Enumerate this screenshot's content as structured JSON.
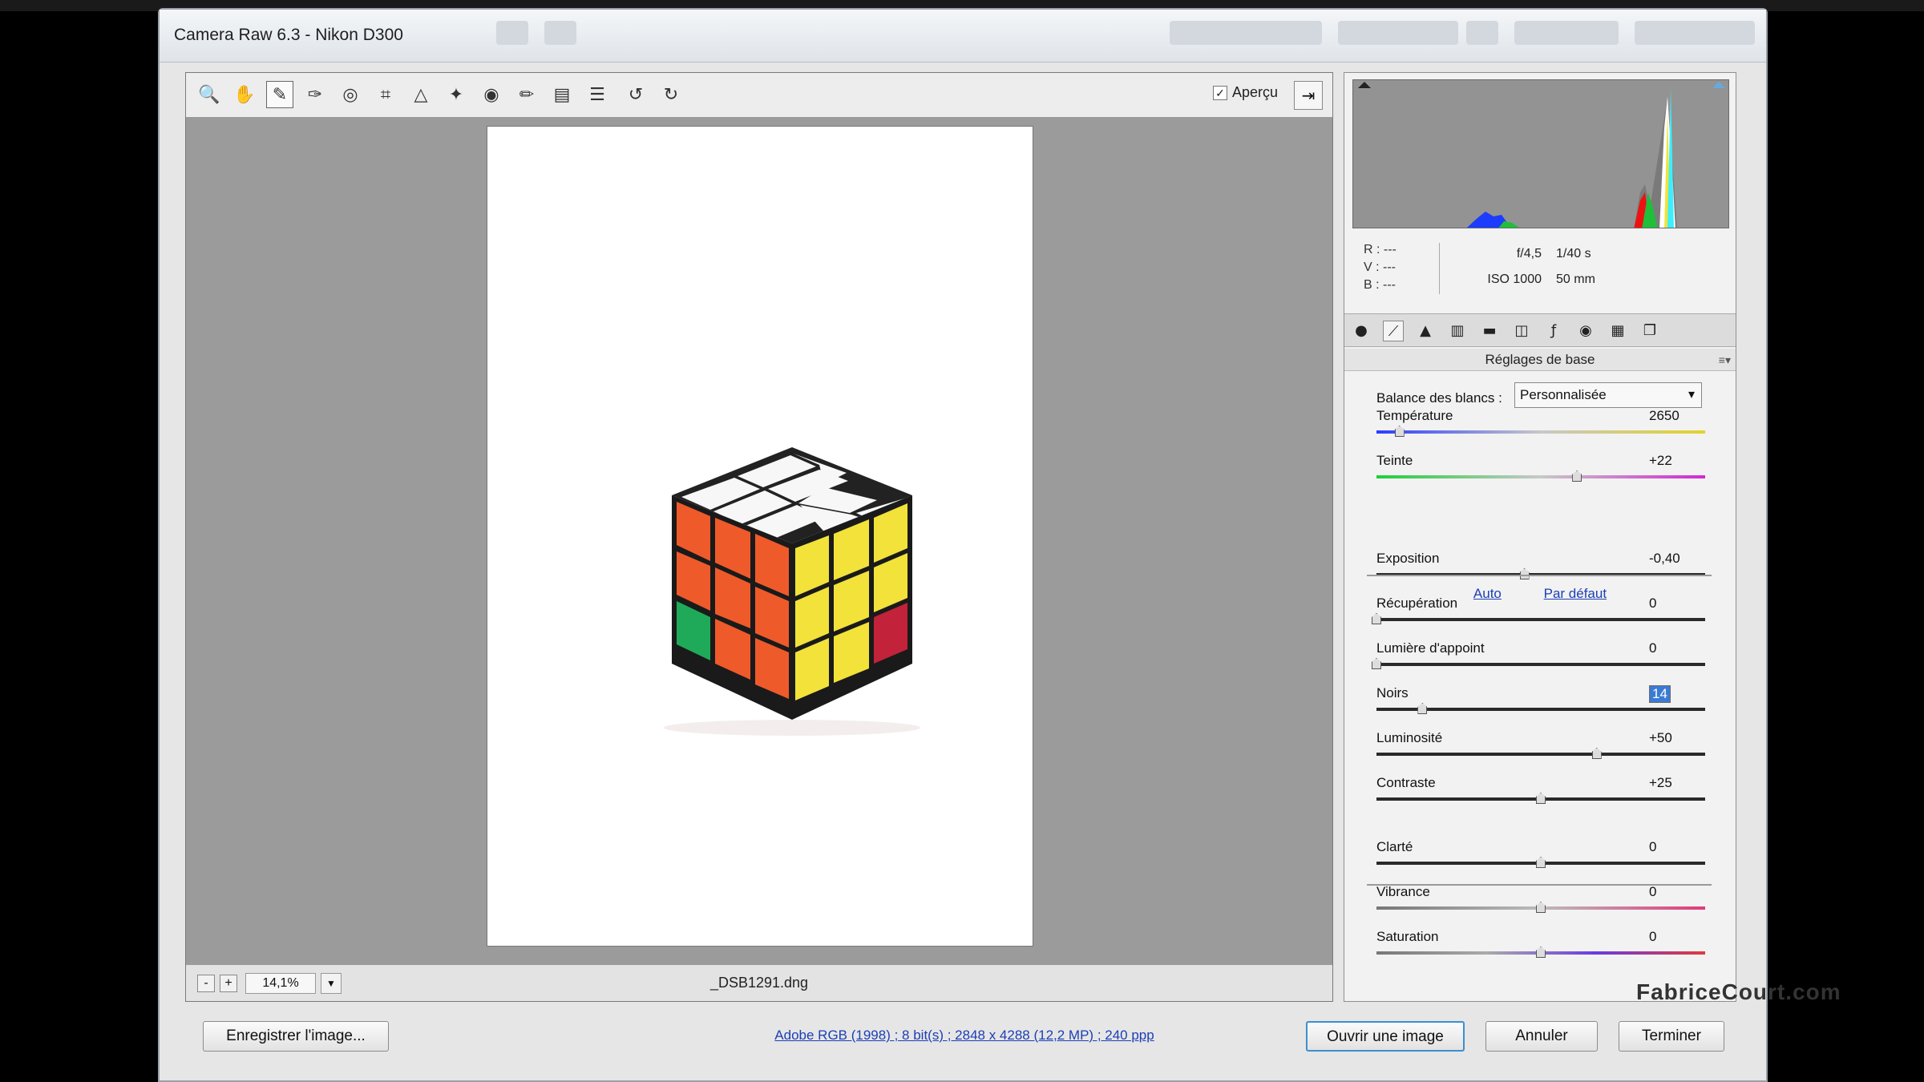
{
  "window": {
    "title": "Camera Raw 6.3  -  Nikon D300"
  },
  "toolbar": {
    "tools": [
      {
        "name": "zoom-tool",
        "glyph": "🔍"
      },
      {
        "name": "hand-tool",
        "glyph": "✋"
      },
      {
        "name": "white-balance-tool",
        "glyph": "✎"
      },
      {
        "name": "color-sampler-tool",
        "glyph": "✑"
      },
      {
        "name": "targeted-adjustment-tool",
        "glyph": "◎"
      },
      {
        "name": "crop-tool",
        "glyph": "⌗"
      },
      {
        "name": "straighten-tool",
        "glyph": "△"
      },
      {
        "name": "spot-removal-tool",
        "glyph": "✦"
      },
      {
        "name": "red-eye-tool",
        "glyph": "◉"
      },
      {
        "name": "adjustment-brush-tool",
        "glyph": "✏"
      },
      {
        "name": "graduated-filter-tool",
        "glyph": "▤"
      },
      {
        "name": "preferences-tool",
        "glyph": "☰"
      },
      {
        "name": "rotate-left-tool",
        "glyph": "↺"
      },
      {
        "name": "rotate-right-tool",
        "glyph": "↻"
      }
    ],
    "preview_label": "Aperçu",
    "preview_checked": "✓"
  },
  "bottombar": {
    "zoom_out": "-",
    "zoom_in": "+",
    "zoom_value": "14,1%",
    "filename": "_DSB1291.dng"
  },
  "info": {
    "rgb": [
      "R :  ---",
      "V :  ---",
      "B :  ---"
    ],
    "aperture": "f/4,5",
    "shutter": "1/40 s",
    "iso": "ISO 1000",
    "focal": "50 mm"
  },
  "panel": {
    "section_title": "Réglages de base",
    "white_balance_label": "Balance des blancs :",
    "white_balance_value": "Personnalisée",
    "link_auto": "Auto",
    "link_default": "Par défaut",
    "sliders": [
      {
        "label": "Température",
        "value": "2650",
        "pos": 0.07
      },
      {
        "label": "Teinte",
        "value": "+22",
        "pos": 0.61
      },
      {
        "label": "Exposition",
        "value": "-0,40",
        "pos": 0.45
      },
      {
        "label": "Récupération",
        "value": "0",
        "pos": 0.0
      },
      {
        "label": "Lumière d'appoint",
        "value": "0",
        "pos": 0.0
      },
      {
        "label": "Noirs",
        "value": "14",
        "pos": 0.14
      },
      {
        "label": "Luminosité",
        "value": "+50",
        "pos": 0.67
      },
      {
        "label": "Contraste",
        "value": "+25",
        "pos": 0.5
      },
      {
        "label": "Clarté",
        "value": "0",
        "pos": 0.5
      },
      {
        "label": "Vibrance",
        "value": "0",
        "pos": 0.5
      },
      {
        "label": "Saturation",
        "value": "0",
        "pos": 0.5
      }
    ]
  },
  "footer": {
    "save_button": "Enregistrer l'image...",
    "info_link": "Adobe RGB (1998) ; 8 bit(s) ; 2848 x 4288 (12,2 MP) ; 240 ppp",
    "open_button": "Ouvrir une image",
    "cancel_button": "Annuler",
    "done_button": "Terminer"
  },
  "watermark": "FabriceCourt.com",
  "colors": {
    "accent": "#3c8fd0",
    "link": "#1b3fb5",
    "canvas": "#9b9b9b"
  }
}
